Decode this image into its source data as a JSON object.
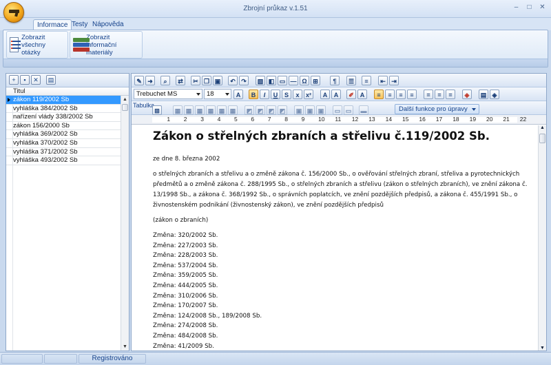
{
  "window": {
    "title": "Zbrojní průkaz v.1.51",
    "minimize": "–",
    "maximize": "□",
    "close": "✕"
  },
  "ribbon": {
    "tabs": [
      {
        "label": "Informace",
        "active": true
      },
      {
        "label": "Testy",
        "active": false
      },
      {
        "label": "Nápověda",
        "active": false
      }
    ],
    "buttons": [
      {
        "label": "Zobrazit všechny otázky",
        "icon": "question-list-icon"
      },
      {
        "label": "Zobrazit informační materiály",
        "icon": "books-icon"
      }
    ]
  },
  "list": {
    "column_header": "Titul",
    "rows": [
      {
        "label": "zákon 119/2002 Sb",
        "selected": true
      },
      {
        "label": "vyhláška 384/2002 Sb",
        "selected": false
      },
      {
        "label": "nařízení vlády 338/2002 Sb",
        "selected": false
      },
      {
        "label": "zákon 156/2000 Sb",
        "selected": false
      },
      {
        "label": "vyhláška 369/2002 Sb",
        "selected": false
      },
      {
        "label": "vyhláška 370/2002 Sb",
        "selected": false
      },
      {
        "label": "vyhláška 371/2002 Sb",
        "selected": false
      },
      {
        "label": "vyhláška 493/2002 Sb",
        "selected": false
      }
    ]
  },
  "editor": {
    "font_name": "Trebuchet MS",
    "font_size": "18",
    "table_label": "Tabulka",
    "more_functions": "Další funkce pro úpravy",
    "ruler_numbers": [
      "1",
      "2",
      "3",
      "4",
      "5",
      "6",
      "7",
      "8",
      "9",
      "10",
      "11",
      "12",
      "13",
      "14",
      "15",
      "16",
      "17",
      "18",
      "19",
      "20",
      "21",
      "22"
    ],
    "document": {
      "title": "Zákon o střelných zbraních a střelivu č.119/2002 Sb.",
      "date": "ze dne 8. března 2002",
      "body": "o střelných zbraních a střelivu a o změně zákona č. 156/2000 Sb., o ověřování střelných zbraní, střeliva a pyrotechnických předmětů a o změně zákona č. 288/1995 Sb., o střelných zbraních a střelivu (zákon o střelných zbraních), ve znění zákona č. 13/1998 Sb., a zákona č. 368/1992 Sb., o správních poplatcích, ve znění pozdějších předpisů, a zákona č. 455/1991 Sb., o živnostenském podnikání (živnostenský zákon), ve znění pozdějších předpisů",
      "short_title": "(zákon o zbraních)",
      "amendments": [
        "Změna: 320/2002 Sb.",
        "Změna: 227/2003 Sb.",
        "Změna: 228/2003 Sb.",
        "Změna: 537/2004 Sb.",
        "Změna: 359/2005 Sb.",
        "Změna: 444/2005 Sb.",
        "Změna: 310/2006 Sb.",
        "Změna: 170/2007 Sb.",
        "Změna: 124/2008 Sb., 189/2008 Sb.",
        "Změna: 274/2008 Sb.",
        "Změna: 484/2008 Sb.",
        "Změna: 41/2009 Sb."
      ]
    }
  },
  "statusbar": {
    "text": "Registrováno"
  },
  "colors": {
    "selection": "#3399ff",
    "accent": "#15428b",
    "frame": "#c9d9ee"
  }
}
